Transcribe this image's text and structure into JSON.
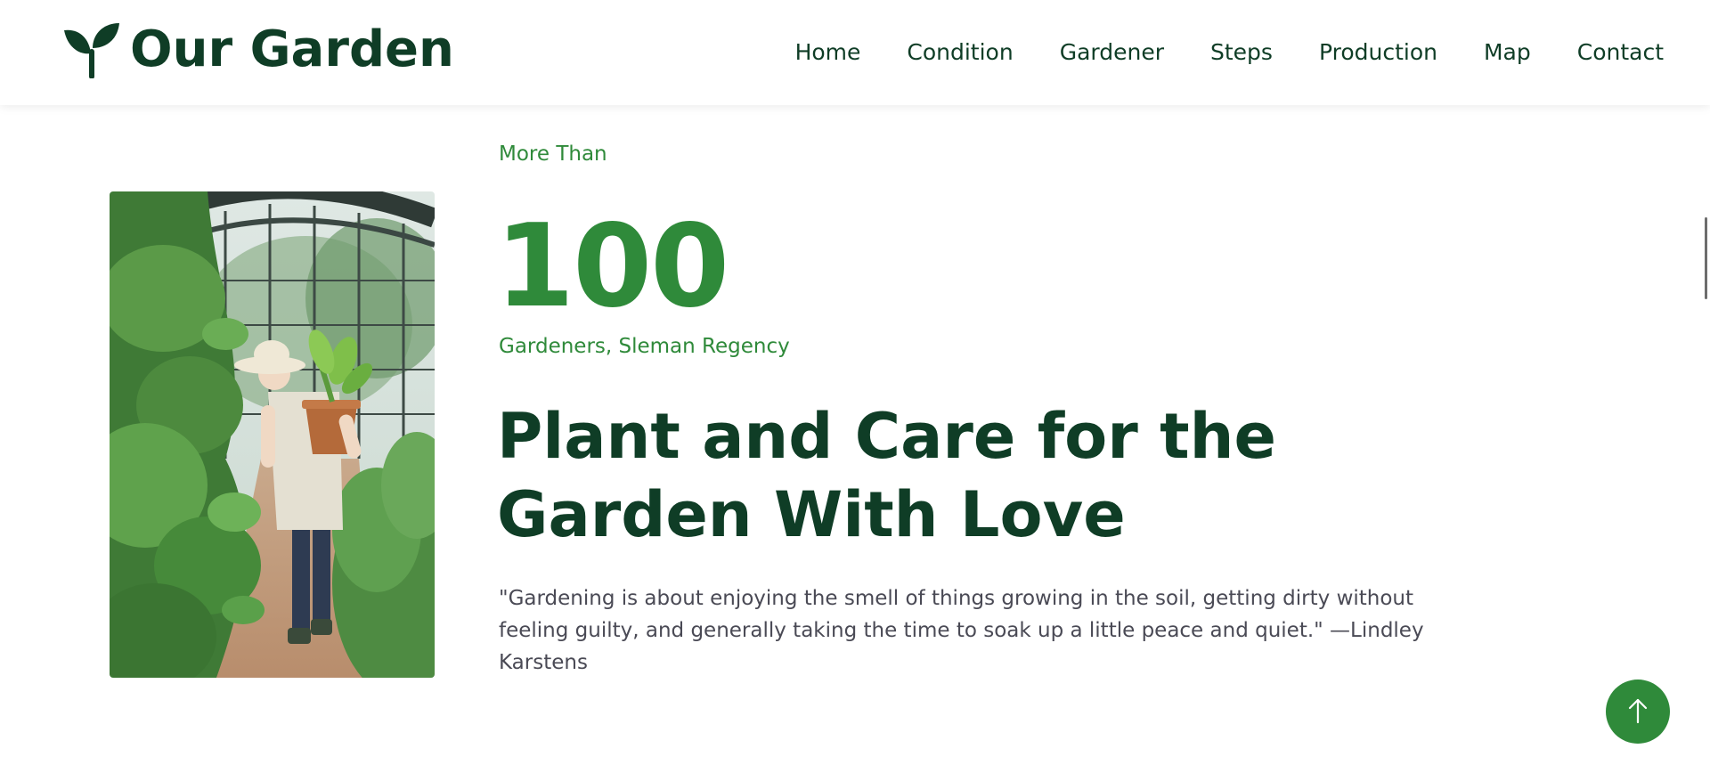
{
  "header": {
    "logo_text": "Our Garden",
    "logo_icon": "sprout-icon",
    "nav": [
      {
        "label": "Home"
      },
      {
        "label": "Condition"
      },
      {
        "label": "Gardener"
      },
      {
        "label": "Steps"
      },
      {
        "label": "Production"
      },
      {
        "label": "Map"
      },
      {
        "label": "Contact"
      }
    ]
  },
  "hero": {
    "eyebrow": "More Than",
    "stat_number": "100",
    "stat_caption": "Gardeners, Sleman Regency",
    "headline": "Plant and Care for the Garden With Love",
    "quote": "\"Gardening is about enjoying the smell of things growing in the soil, getting dirty without feeling guilty, and generally taking the time to soak up a little peace and quiet.\" —Lindley Karstens"
  },
  "scroll_top": {
    "icon": "arrow-up-icon"
  },
  "colors": {
    "brand_dark": "#0f3d26",
    "accent_green": "#2f8a3a",
    "body_text": "#4a4a55",
    "header_bg": "#ffffff"
  }
}
